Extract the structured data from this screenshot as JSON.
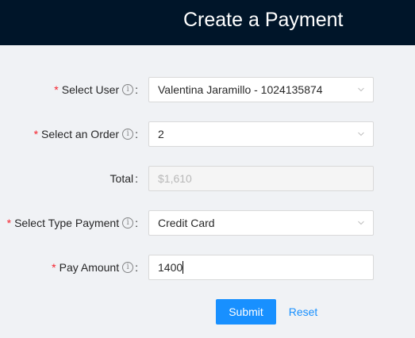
{
  "header": {
    "title": "Create a Payment"
  },
  "form": {
    "user": {
      "label": "Select User",
      "value": "Valentina Jaramillo - 1024135874"
    },
    "order": {
      "label": "Select an Order",
      "value": "2"
    },
    "total": {
      "label": "Total",
      "value": "$1,610"
    },
    "payment_type": {
      "label": "Select Type Payment",
      "value": "Credit Card"
    },
    "amount": {
      "label": "Pay Amount",
      "value": "1400"
    }
  },
  "buttons": {
    "submit": "Submit",
    "reset": "Reset"
  },
  "colors": {
    "header_bg": "#001529",
    "primary": "#1890ff",
    "required": "#f5222d"
  }
}
